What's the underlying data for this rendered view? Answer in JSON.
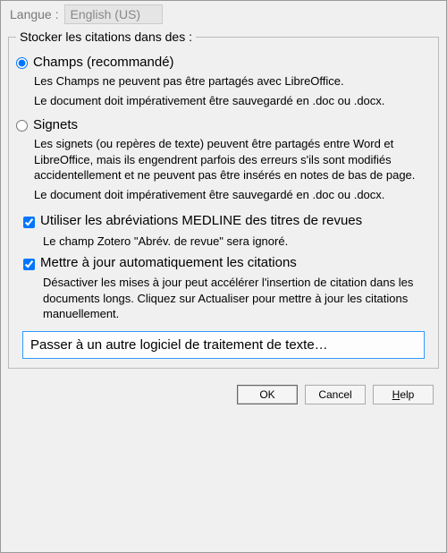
{
  "lang": {
    "label": "Langue :",
    "value": "English (US)"
  },
  "group": {
    "legend": "Stocker les citations dans des :",
    "fields": {
      "title": "Champs (recommandé)",
      "desc1": "Les Champs ne peuvent pas être partagés avec LibreOffice.",
      "desc2": "Le document doit impérativement être sauvegardé en .doc ou .docx."
    },
    "bookmarks": {
      "title": "Signets",
      "desc1": "Les signets (ou repères de texte) peuvent être partagés entre Word et LibreOffice, mais ils engendrent parfois des erreurs s'ils sont modifiés accidentellement et ne peuvent pas être insérés en notes de bas de page.",
      "desc2": "Le document doit impérativement être sauvegardé en .doc ou .docx."
    },
    "medline": {
      "title": "Utiliser les abréviations MEDLINE des titres de revues",
      "desc": "Le champ Zotero \"Abrév. de revue\" sera ignoré."
    },
    "autoupdate": {
      "title": "Mettre à jour automatiquement les citations",
      "desc": "Désactiver les mises à jour peut accélérer l'insertion de citation dans les documents longs. Cliquez sur Actualiser pour mettre à jour les citations manuellement."
    },
    "switch": "Passer à un autre logiciel de traitement de texte…"
  },
  "buttons": {
    "ok": "OK",
    "cancel": "Cancel",
    "help": "Help"
  }
}
